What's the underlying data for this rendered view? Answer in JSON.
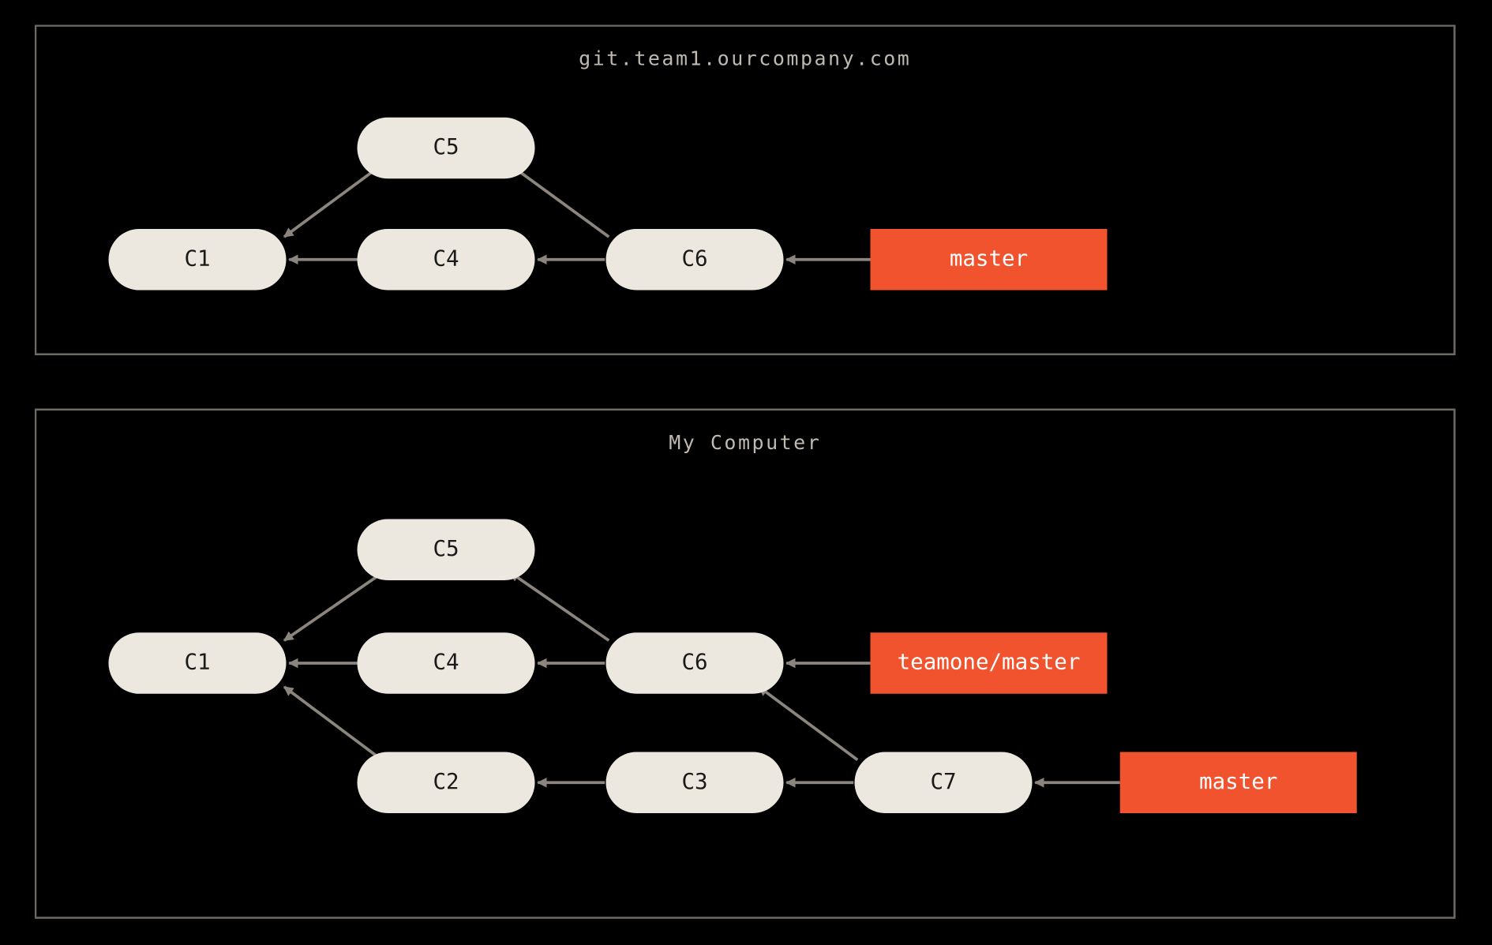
{
  "colors": {
    "bg": "#000000",
    "node_fill": "#ece8e0",
    "node_text": "#1a1a1a",
    "branch_fill": "#f0532d",
    "branch_text": "#ffffff",
    "border": "#706a64",
    "arrow": "#8b857e",
    "title_text": "#bfb9b0"
  },
  "panel_top": {
    "title": "git.team1.ourcompany.com",
    "commits": {
      "c1": "C1",
      "c4": "C4",
      "c5": "C5",
      "c6": "C6"
    },
    "branches": {
      "master": "master"
    },
    "edges_desc": [
      "C4 -> C1",
      "C5 -> C1",
      "C6 -> C4",
      "C6 -> C5",
      "master -> C6"
    ]
  },
  "panel_bottom": {
    "title": "My Computer",
    "commits": {
      "c1": "C1",
      "c2": "C2",
      "c3": "C3",
      "c4": "C4",
      "c5": "C5",
      "c6": "C6",
      "c7": "C7"
    },
    "branches": {
      "teamone_master": "teamone/master",
      "master": "master"
    },
    "edges_desc": [
      "C4 -> C1",
      "C5 -> C1",
      "C2 -> C1",
      "C6 -> C4",
      "C6 -> C5",
      "C3 -> C2",
      "C7 -> C3",
      "C7 -> C6",
      "teamone/master -> C6",
      "master -> C7"
    ]
  }
}
